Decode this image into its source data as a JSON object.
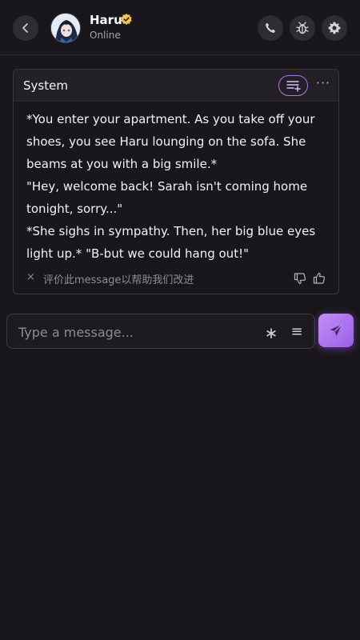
{
  "header": {
    "character_name": "Haru",
    "status": "Online",
    "icons": {
      "back": "chevron-left-icon",
      "verified": "verified-badge-icon",
      "call": "phone-icon",
      "bug": "bug-icon",
      "settings": "gear-icon"
    }
  },
  "message": {
    "title": "System",
    "more": "···",
    "paragraphs": [
      "*You enter your apartment. As you take off your shoes, you see Haru lounging on the sofa. She beams at you with a big smile.*",
      "\"Hey, welcome back! Sarah isn't coming home tonight, sorry...\"",
      "*She sighs in sympathy. Then, her big blue eyes light up.* \"B-but we could hang out!\""
    ],
    "dismiss": "×",
    "rating_prompt": "评价此message以帮助我们改进"
  },
  "composer": {
    "placeholder": "Type a message...",
    "asterisk": "∗",
    "menu": "≡"
  },
  "colors": {
    "background": "#19171b",
    "accent": "#a87ae8",
    "verified": "#f2c744"
  }
}
